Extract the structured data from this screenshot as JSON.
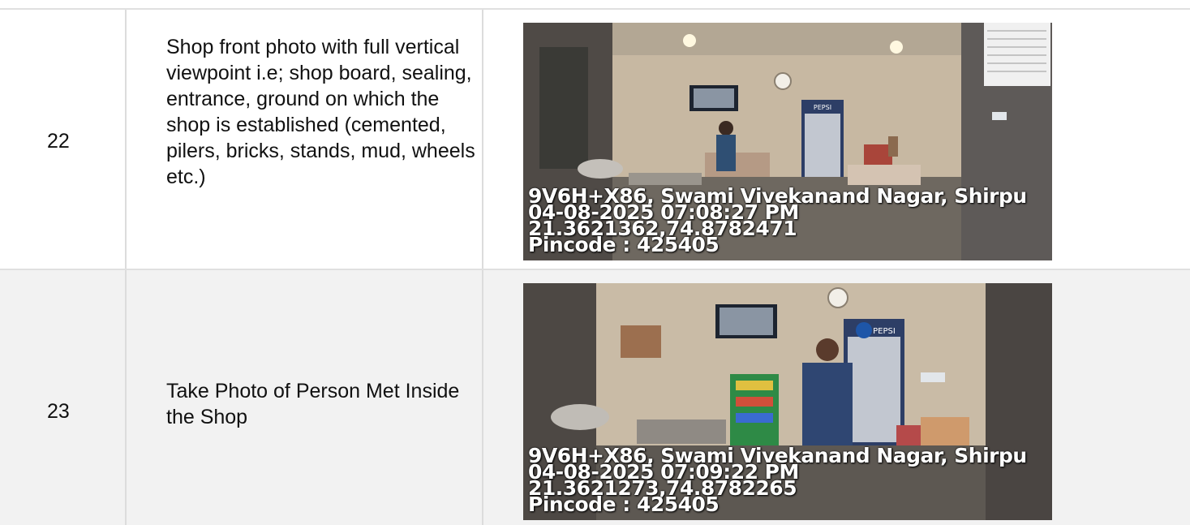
{
  "rows": [
    {
      "number": "22",
      "description": "Shop front photo with full vertical viewpoint i.e; shop board, sealing, entrance, ground on which the shop is established (cemented, pilers, bricks, stands, mud, wheels etc.)",
      "photo": {
        "address": "9V6H+X86, Swami Vivekanand Nagar, Shirpu",
        "datetime": "04-08-2025 07:08:27 PM",
        "coordinates": "21.3621362,74.8782471",
        "pincode": "Pincode : 425405",
        "brand_sign": "PEPSI"
      }
    },
    {
      "number": "23",
      "description": "Take Photo of Person Met Inside the Shop",
      "photo": {
        "address": "9V6H+X86, Swami Vivekanand Nagar, Shirpu",
        "datetime": "04-08-2025 07:09:22 PM",
        "coordinates": "21.3621273,74.8782265",
        "pincode": "Pincode : 425405",
        "brand_sign": "PEPSI"
      }
    }
  ],
  "colors": {
    "border": "#e0e0e0",
    "row_alt_background": "#f2f2f2",
    "text": "#111111"
  }
}
